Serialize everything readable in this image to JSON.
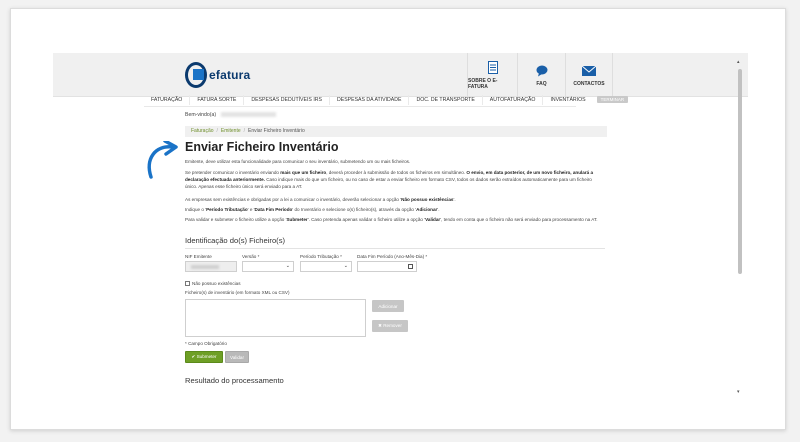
{
  "header": {
    "logo_text": "efatura",
    "links": [
      {
        "label": "SOBRE O E-FATURA",
        "icon": "document-icon"
      },
      {
        "label": "FAQ",
        "icon": "chat-bubble-icon"
      },
      {
        "label": "CONTACTOS",
        "icon": "envelope-icon"
      }
    ]
  },
  "nav": {
    "items": [
      "FATURAÇÃO",
      "FATURA SORTE",
      "DESPESAS DEDUTÍVEIS IRS",
      "DESPESAS DA ATIVIDADE",
      "DOC. DE TRANSPORTE",
      "AUTOFATURAÇÃO",
      "INVENTÁRIOS"
    ],
    "button_label": "TERMINAR"
  },
  "welcome_label": "Bem-vindo(a)",
  "breadcrumb": {
    "items": [
      "Faturação",
      "Emitente",
      "Enviar Ficheiro Inventário"
    ]
  },
  "page": {
    "title": "Enviar Ficheiro Inventário",
    "p1": "Emitente, deve utilizar esta funcionalidade para comunicar o seu inventário, submetendo um ou mais ficheiros.",
    "p2_a": "Se pretender comunicar o inventário enviando ",
    "p2_b": "mais que um ficheiro",
    "p2_c": ", deverá proceder à submissão de todos os ficheiros em simultâneo. ",
    "p2_d": "O envio, em data posterior, de um novo ficheiro, anulará a declaração efectuada anteriormente.",
    "p2_e": " Caso indique mais do que um ficheiro, ou no caso de estar a enviar ficheiro em formato CSV, todos os dados serão extraídos automaticamente para um ficheiro único. Apenas esse ficheiro único será enviado para a AT.",
    "p3_a": "As empresas sem existências e obrigadas por a lei a comunicar o inventário, deverão selecionar a opção '",
    "p3_b": "Não possuo existências",
    "p3_c": "'.",
    "p4_a": "Indique o '",
    "p4_b": "Período Tributação",
    "p4_c": "' e '",
    "p4_d": "Data Fim Período",
    "p4_e": "' do Inventário e selecione o(s) ficheiro(s), através da opção '",
    "p4_f": "Adicionar",
    "p4_g": "'.",
    "p5_a": "Para validar e submeter o ficheiro utilize a opção '",
    "p5_b": "Submeter",
    "p5_c": "'. Caso pretenda apenas validar o ficheiro utilize a opção '",
    "p5_d": "Validar",
    "p5_e": "', tendo em conta que o ficheiro não será enviado para processamento na AT."
  },
  "form": {
    "section_title": "Identificação do(s) Ficheiro(s)",
    "nif_label": "NIF Emitente",
    "versao_label": "Versão *",
    "periodo_label": "Período Tributação *",
    "data_label": "Data Fim Período (Ano-Mês-Dia) *",
    "checkbox_label": "Não possuo existências",
    "files_label": "Ficheiro(s) de inventário (em formato XML ou CSV)",
    "add_button": "Adicionar",
    "remove_button": "✖ Remover",
    "required_note": "* Campo Obrigatório",
    "submit_button": "✔ Submeter",
    "validate_button": "Validar"
  },
  "result_title": "Resultado do processamento",
  "colors": {
    "accent_green": "#6e9f25",
    "brand_blue": "#0b3a6e",
    "arrow_blue": "#1a73c7"
  }
}
